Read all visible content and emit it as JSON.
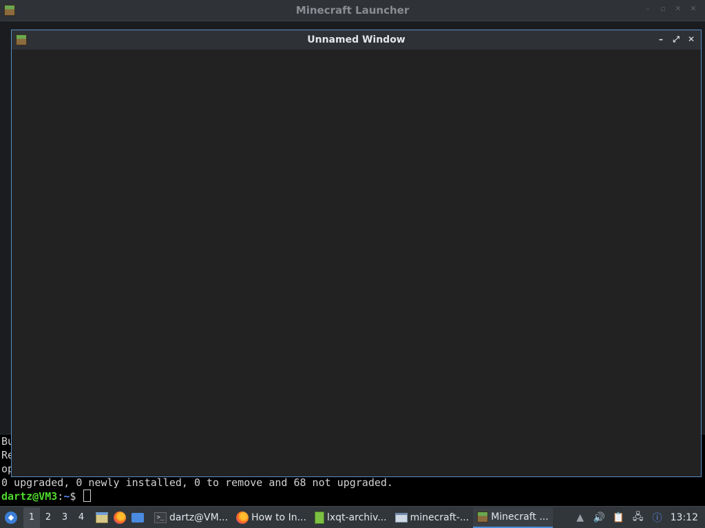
{
  "launcher": {
    "title": "Minecraft Launcher",
    "controls": [
      "–",
      "▫",
      "✕",
      "✕"
    ]
  },
  "unnamed_window": {
    "title": "Unnamed Window",
    "controls": {
      "minimize": "–",
      "maximize": "⤢",
      "close": "✕"
    }
  },
  "terminal": {
    "partial_lines": [
      "Bu",
      "Re",
      "op"
    ],
    "summary_line": "0 upgraded, 0 newly installed, 0 to remove and 68 not upgraded.",
    "prompt_user": "dartz@VM3",
    "prompt_sep": ":",
    "prompt_path": "~",
    "prompt_symbol": "$ "
  },
  "taskbar": {
    "desktops": [
      "1",
      "2",
      "3",
      "4"
    ],
    "active_desktop": "1",
    "tasks": [
      {
        "label": "dartz@VM...",
        "icon": "terminal-icon"
      },
      {
        "label": "How to In...",
        "icon": "firefox-icon"
      },
      {
        "label": "lxqt-archiv...",
        "icon": "archive-icon"
      },
      {
        "label": "minecraft-...",
        "icon": "window-icon"
      },
      {
        "label": "Minecraft ...",
        "icon": "grass-block-icon",
        "active": true
      }
    ],
    "clock": "13:12"
  },
  "colors": {
    "window_border": "#5b8fc7",
    "prompt_user": "#4fdb2e",
    "prompt_path": "#5a8df5",
    "active_task_underline": "#4a90d9"
  }
}
